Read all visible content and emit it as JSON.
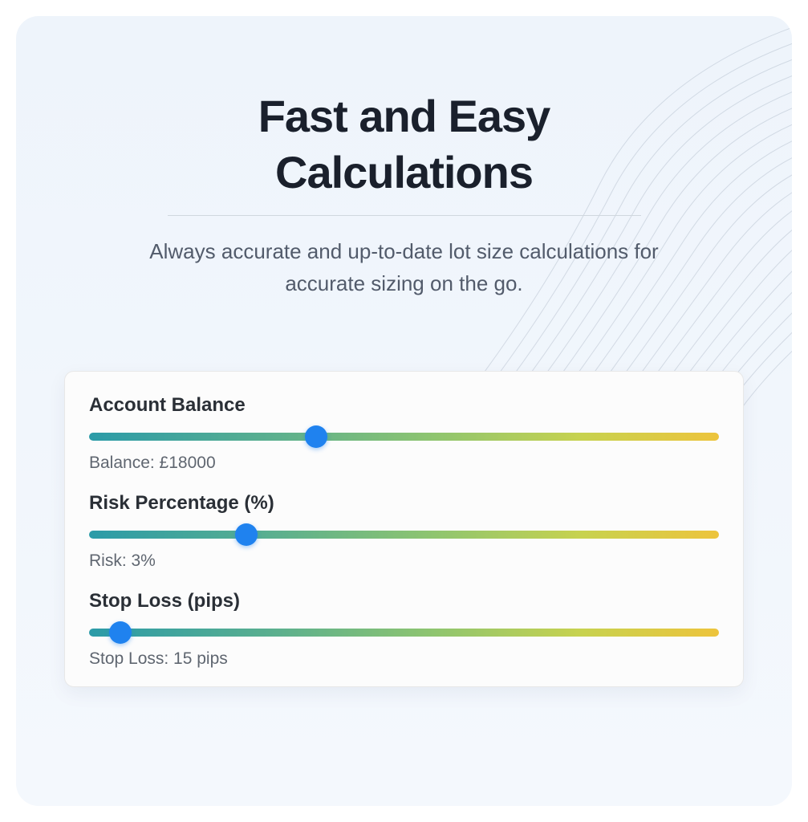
{
  "header": {
    "title_line1": "Fast and Easy",
    "title_line2": "Calculations",
    "subtitle": "Always accurate and up-to-date lot size calculations for accurate sizing on the go."
  },
  "sliders": {
    "balance": {
      "label": "Account Balance",
      "value_text": "Balance: £18000",
      "thumb_percent": 36
    },
    "risk": {
      "label": "Risk Percentage (%)",
      "value_text": "Risk: 3%",
      "thumb_percent": 25
    },
    "stoploss": {
      "label": "Stop Loss (pips)",
      "value_text": "Stop Loss: 15 pips",
      "thumb_percent": 5
    }
  }
}
